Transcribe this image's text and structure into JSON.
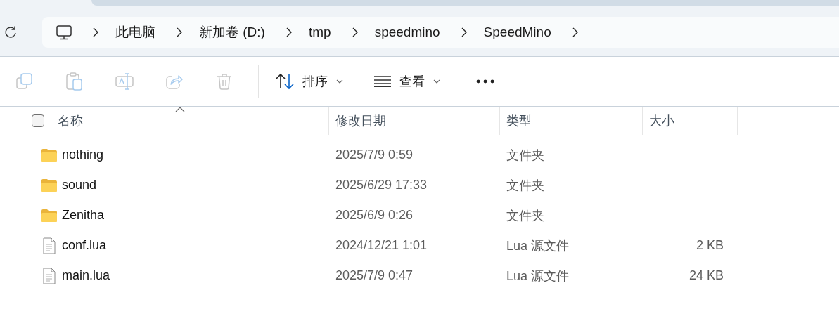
{
  "address_bar": {
    "breadcrumbs": [
      "此电脑",
      "新加卷 (D:)",
      "tmp",
      "speedmino",
      "SpeedMino"
    ]
  },
  "toolbar": {
    "actions": [
      {
        "kind": "copy",
        "disabled": true
      },
      {
        "kind": "paste",
        "disabled": true
      },
      {
        "kind": "rename",
        "disabled": true
      },
      {
        "kind": "share",
        "disabled": true
      },
      {
        "kind": "delete",
        "disabled": true
      }
    ],
    "sort": {
      "label": "排序"
    },
    "view": {
      "label": "查看"
    }
  },
  "file_list": {
    "select_all": {
      "checked": false
    },
    "columns": [
      {
        "label": "名称",
        "sorted": true
      },
      {
        "label": "修改日期",
        "sorted": false
      },
      {
        "label": "类型",
        "sorted": false
      },
      {
        "label": "大小",
        "sorted": false
      }
    ],
    "rows": [
      {
        "kind": "folder",
        "name": "nothing",
        "modified": "2025/7/9 0:59",
        "type": "文件夹"
      },
      {
        "kind": "folder",
        "name": "sound",
        "modified": "2025/6/29 17:33",
        "type": "文件夹"
      },
      {
        "kind": "folder",
        "name": "Zenitha",
        "modified": "2025/6/9 0:26",
        "type": "文件夹"
      },
      {
        "kind": "file",
        "name": "conf.lua",
        "modified": "2024/12/21 1:01",
        "type": "Lua 源文件",
        "size": "2 KB"
      },
      {
        "kind": "file",
        "name": "main.lua",
        "modified": "2025/7/9 0:47",
        "type": "Lua 源文件",
        "size": "24 KB"
      }
    ]
  }
}
